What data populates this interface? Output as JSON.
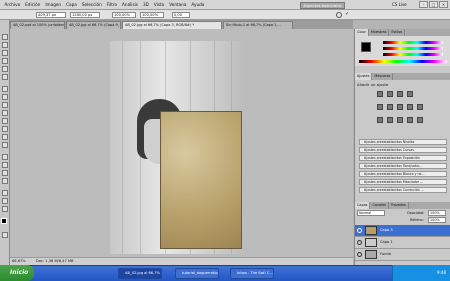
{
  "menubar": {
    "items": [
      "Archivo",
      "Edición",
      "Imagen",
      "Capa",
      "Selección",
      "Filtro",
      "Análisis",
      "3D",
      "Vista",
      "Ventana",
      "Ayuda"
    ],
    "workspace_label": "Aspectos esenciales",
    "cslive_label": "CS Live"
  },
  "optionsbar": {
    "x_value": "409,37 px",
    "y_value": "1280,00 px",
    "w_value": "100,00%",
    "h_value": "100,00%",
    "angle_value": "0,00"
  },
  "tabs": [
    {
      "label": "AB_02.psd al 100% (unfolded...)"
    },
    {
      "label": "AB_02.jpg al 66,7% (Capa 9, RG..."
    },
    {
      "label": "AB_02.jpg al 66,7% (Capa 3, RGB/8#) *"
    },
    {
      "label": "Sin título-1 al 66,7% (Capa 1,..."
    }
  ],
  "statusbar": {
    "zoom": "66,67%",
    "doc_info": "Doc: 1,38 M/8,47 MB"
  },
  "panels": {
    "color_tabs": [
      "Color",
      "Muestras",
      "Estilos"
    ],
    "adjust_tabs": [
      "Ajustes",
      "Máscaras"
    ],
    "adjust_title": "Añadir un ajuste",
    "presets": [
      "Ajustes preestablecidos Niveles",
      "Ajustes preestablecidos Curvas",
      "Ajustes preestablecidos Exposición",
      "Ajustes preestablecidos Tono/satur...",
      "Ajustes preestablecidos Blanco y ne...",
      "Ajustes preestablecidos Mezclador ...",
      "Ajustes preestablecidos Corrección ..."
    ],
    "layer_tabs": [
      "Capas",
      "Canales",
      "Trazados"
    ],
    "blend_mode": "Normal",
    "opacity_label": "Opacidad:",
    "opacity_value": "100%",
    "fill_label": "Relleno:",
    "fill_value": "100%",
    "layers": [
      {
        "name": "Capa 3"
      },
      {
        "name": "Capa 1"
      },
      {
        "name": "Fondo"
      }
    ]
  },
  "taskbar": {
    "start_label": "Inicio",
    "tasks": [
      "AB_02.jpg al 66,7% (C...",
      "tutorial_daguerrotipo",
      "Inbox - The Bat! C..."
    ],
    "clock": "9:48"
  },
  "colors": {
    "taskbar": "#2456c4",
    "start": "#2d8a2d",
    "texture": "#b69f68"
  }
}
